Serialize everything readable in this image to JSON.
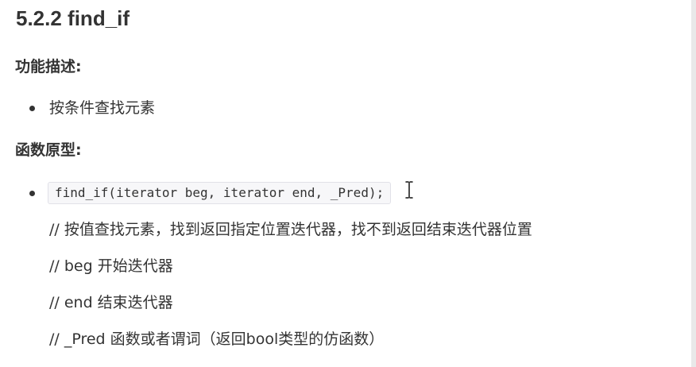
{
  "heading": "5.2.2 find_if",
  "section_function": "功能描述:",
  "function_items": [
    "按条件查找元素"
  ],
  "section_prototype": "函数原型:",
  "prototype_code": "find_if(iterator beg, iterator end, _Pred);",
  "comments": [
    "// 按值查找元素，找到返回指定位置迭代器，找不到返回结束迭代器位置",
    "// beg 开始迭代器",
    "// end 结束迭代器",
    "// _Pred 函数或者谓词（返回bool类型的仿函数）"
  ],
  "cursor": "text-cursor-icon"
}
